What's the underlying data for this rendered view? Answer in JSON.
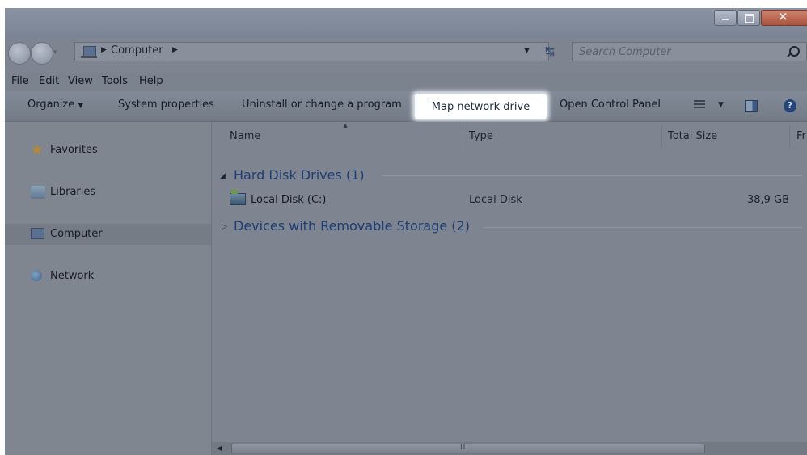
{
  "address": {
    "location": "Computer",
    "search_placeholder": "Search Computer"
  },
  "menu": [
    "File",
    "Edit",
    "View",
    "Tools",
    "Help"
  ],
  "toolbar": {
    "organize": "Organize",
    "system_properties": "System properties",
    "uninstall": "Uninstall or change a program",
    "map_network_drive": "Map network drive",
    "open_control_panel": "Open Control Panel"
  },
  "sidebar": {
    "items": [
      {
        "label": "Favorites",
        "icon": "star-icon"
      },
      {
        "label": "Libraries",
        "icon": "libraries-icon"
      },
      {
        "label": "Computer",
        "icon": "computer-icon",
        "selected": true
      },
      {
        "label": "Network",
        "icon": "network-icon"
      }
    ]
  },
  "columns": {
    "name": "Name",
    "type": "Type",
    "total_size": "Total Size",
    "free": "Fr"
  },
  "groups": {
    "hard_disk": {
      "title": "Hard Disk Drives (1)",
      "items": [
        {
          "name": "Local Disk (C:)",
          "type": "Local Disk",
          "total_size": "38,9 GB"
        }
      ]
    },
    "removable": {
      "title": "Devices with Removable Storage (2)"
    }
  },
  "colors": {
    "highlight": "#ffffff",
    "group_heading": "#1f3e75"
  }
}
